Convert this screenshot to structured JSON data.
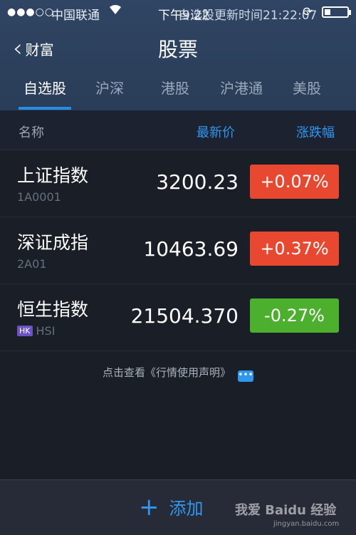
{
  "status_bar": {
    "signal": "●●●○○",
    "carrier": "中国联通",
    "wifi_icon": "wifi-icon",
    "time": "下午9:22",
    "overlay_text": "自选股更新时间21:22:07"
  },
  "nav": {
    "back_label": "财富",
    "title": "股票"
  },
  "tabs": [
    {
      "label": "自选股",
      "active": true
    },
    {
      "label": "沪深",
      "active": false
    },
    {
      "label": "港股",
      "active": false
    },
    {
      "label": "沪港通",
      "active": false
    },
    {
      "label": "美股",
      "active": false
    }
  ],
  "columns": {
    "name": "名称",
    "price": "最新价",
    "change": "涨跌幅"
  },
  "stocks": [
    {
      "name": "上证指数",
      "code": "1A0001",
      "price": "3200.23",
      "change": "+0.07%",
      "color": "#e8482f"
    },
    {
      "name": "深证成指",
      "code": "2A01",
      "price": "10463.69",
      "change": "+0.37%",
      "color": "#e8482f"
    },
    {
      "name": "恒生指数",
      "code": "HSI",
      "tag": "HK",
      "price": "21504.370",
      "change": "-0.27%",
      "color": "#4caf2e"
    }
  ],
  "notice": "点击查看《行情使用声明》",
  "footer": {
    "add_label": "添加",
    "watermark": "我爱 Baidu 经验",
    "watermark_url": "jingyan.baidu.com"
  }
}
